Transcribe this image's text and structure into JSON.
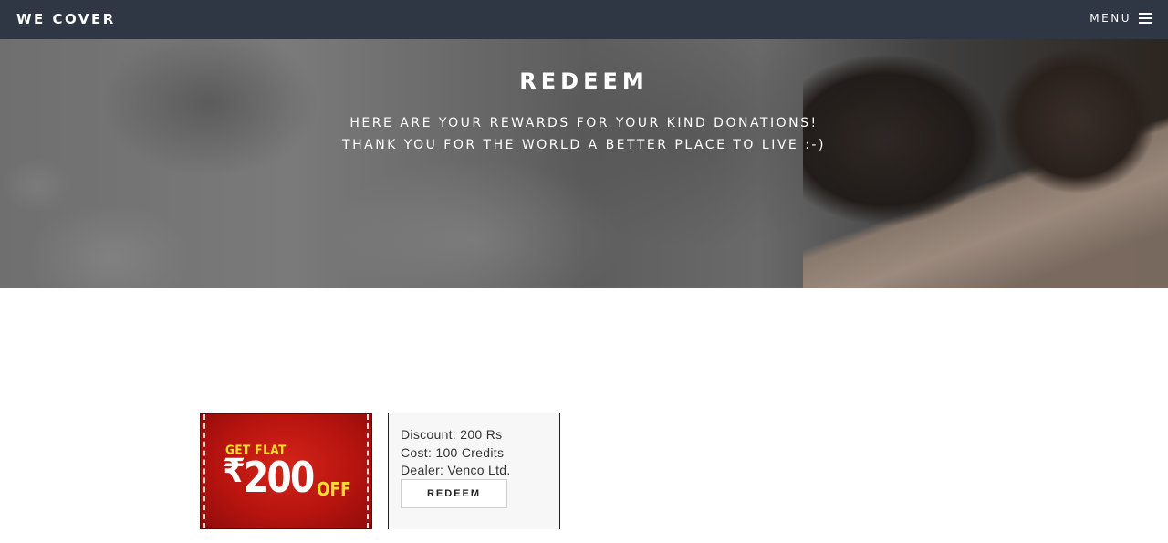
{
  "navbar": {
    "brand": "WE COVER",
    "menu_label": "MENU",
    "menu_icon": "bars-icon"
  },
  "hero": {
    "title": "REDEEM",
    "subtitle_line1": "HERE ARE YOUR REWARDS FOR YOUR KIND DONATIONS!",
    "subtitle_line2": "THANK YOU FOR THE WORLD A BETTER PLACE TO LIVE :-)"
  },
  "coupon": {
    "image_text_top": "GET FLAT",
    "image_currency": "₹",
    "image_amount": "200",
    "image_suffix": "OFF",
    "discount": "Discount: 200 Rs",
    "cost": "Cost: 100 Credits",
    "dealer": "Dealer: Venco Ltd.",
    "button_label": "REDEEM"
  },
  "colors": {
    "navbar_bg": "#2e3743",
    "coupon_red": "#c81c14",
    "coupon_yellow": "#ffde2e"
  }
}
